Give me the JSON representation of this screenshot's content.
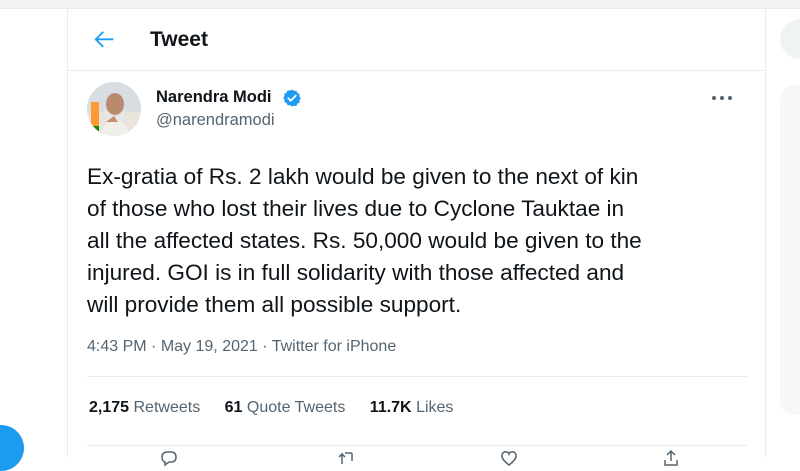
{
  "header": {
    "title": "Tweet"
  },
  "author": {
    "name": "Narendra Modi",
    "handle": "@narendramodi"
  },
  "tweet": {
    "lines": [
      "Ex-gratia of Rs. 2 lakh would be given to the next of kin",
      "of those who lost their lives due to Cyclone Tauktae in",
      "all the affected states. Rs. 50,000 would be given to the",
      "injured. GOI is in full solidarity with those affected and",
      "will provide them all possible support."
    ],
    "time": "4:43 PM",
    "date": "May 19, 2021",
    "source": "Twitter for iPhone",
    "dot": "·"
  },
  "stats": {
    "retweets_count": "2,175",
    "retweets_label": "Retweets",
    "quotes_count": "61",
    "quotes_label": "Quote Tweets",
    "likes_count": "11.7K",
    "likes_label": "Likes"
  },
  "colors": {
    "accent": "#1d9bf0",
    "secondary_text": "#536471",
    "border": "#e6ecf0"
  },
  "icons": [
    "back-arrow-icon",
    "verified-badge-icon",
    "more-options-icon",
    "reply-icon",
    "retweet-icon",
    "like-icon",
    "share-icon"
  ]
}
